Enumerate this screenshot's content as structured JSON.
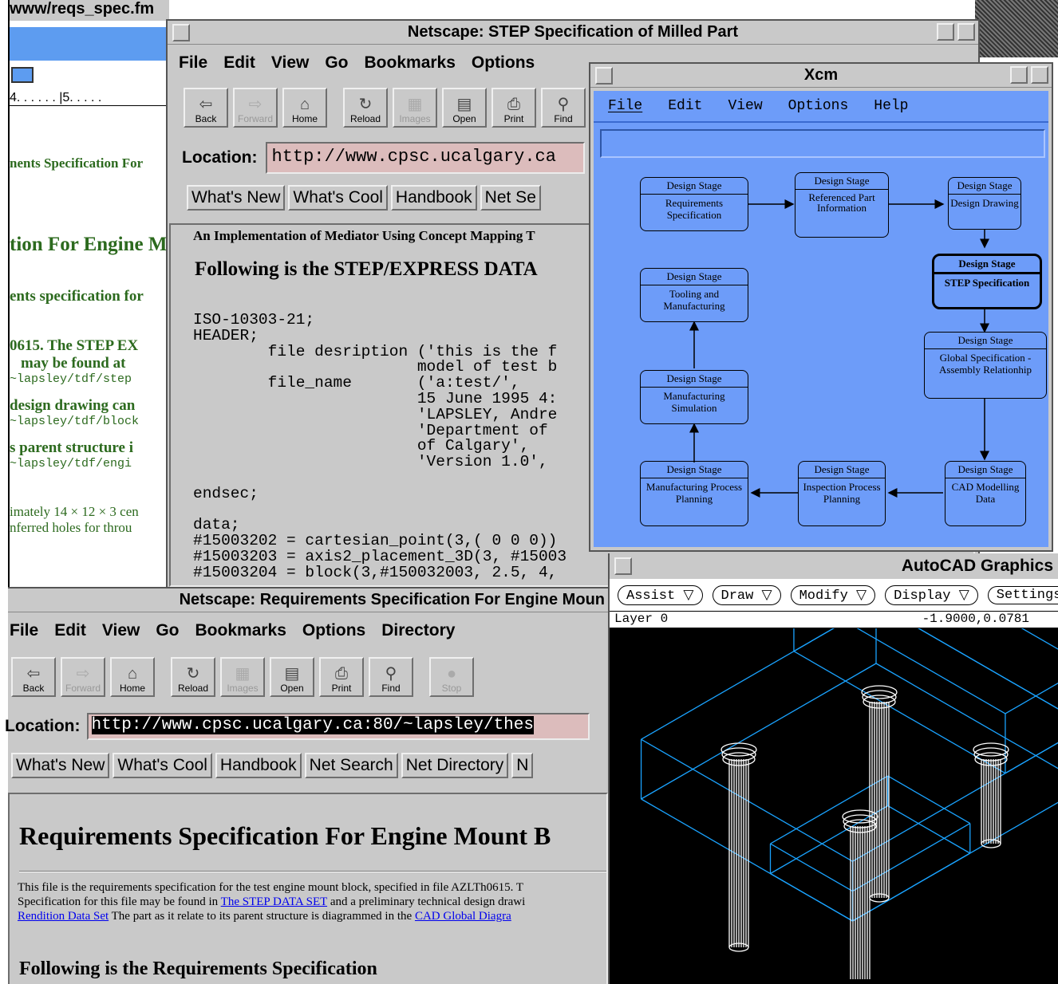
{
  "fm": {
    "title": "www/reqs_spec.fm",
    "ruler": "4. . . . . . |5. . . . .",
    "lines": [
      "nents Specification For",
      "tion For Engine M",
      "ents specification for",
      "0615. The STEP EX",
      "may be found at",
      "~lapsley/tdf/step",
      "design drawing can",
      "~lapsley/tdf/block",
      "s parent structure i",
      "~lapsley/tdf/engi",
      "imately 14 × 12 × 3 cen",
      "nferred holes for throu"
    ]
  },
  "nav1": {
    "title": "Netscape: STEP Specification of Milled Part",
    "menu": [
      "File",
      "Edit",
      "View",
      "Go",
      "Bookmarks",
      "Options"
    ],
    "toolbar": [
      {
        "label": "Back",
        "icon": "back-arrow-icon",
        "glyph": "⇦"
      },
      {
        "label": "Forward",
        "icon": "forward-arrow-icon",
        "glyph": "⇨"
      },
      {
        "label": "Home",
        "icon": "home-icon",
        "glyph": "⌂"
      },
      {
        "label": "Reload",
        "icon": "reload-icon",
        "glyph": "↻"
      },
      {
        "label": "Images",
        "icon": "images-icon",
        "glyph": "▦"
      },
      {
        "label": "Open",
        "icon": "open-icon",
        "glyph": "▤"
      },
      {
        "label": "Print",
        "icon": "print-icon",
        "glyph": "⎙"
      },
      {
        "label": "Find",
        "icon": "find-icon",
        "glyph": "⚲"
      }
    ],
    "location_label": "Location:",
    "location_value": "http://www.cpsc.ucalgary.ca",
    "dirbuttons": [
      "What's New",
      "What's Cool",
      "Handbook",
      "Net Se"
    ],
    "header": "An Implementation of Mediator Using Concept Mapping T",
    "heading": "Following is the STEP/EXPRESS DATA",
    "code": "ISO-10303-21;\nHEADER;\n        file desription ('this is the f\n                        model of test b\n        file_name       ('a:test/',\n                        15 June 1995 4:\n                        'LAPSLEY, Andre\n                        'Department of\n                        of Calgary',\n                        'Version 1.0',\n\nendsec;\n\ndata;\n#15003202 = cartesian_point(3,( 0 0 0))\n#15003203 = axis2_placement_3D(3, #15003\n#15003204 = block(3,#150032003, 2.5, 4,"
  },
  "xcm": {
    "title": "Xcm",
    "menu": [
      "File",
      "Edit",
      "View",
      "Options",
      "Help"
    ],
    "stages": [
      {
        "head": "Design Stage",
        "body": "Requirements Specification"
      },
      {
        "head": "Design Stage",
        "body": "Referenced Part Information"
      },
      {
        "head": "Design Stage",
        "body": "Design Drawing"
      },
      {
        "head": "Design Stage",
        "body": "STEP Specification"
      },
      {
        "head": "Design Stage",
        "body": "Tooling and Manufacturing"
      },
      {
        "head": "Design Stage",
        "body": "Global Specification - Assembly Relationhip"
      },
      {
        "head": "Design Stage",
        "body": "Manufacturing Simulation"
      },
      {
        "head": "Design Stage",
        "body": "Manufacturing Process Planning"
      },
      {
        "head": "Design Stage",
        "body": "Inspection Process Planning"
      },
      {
        "head": "Design Stage",
        "body": "CAD Modelling Data"
      }
    ]
  },
  "nav2": {
    "title": "Netscape: Requirements Specification For Engine Moun",
    "menu": [
      "File",
      "Edit",
      "View",
      "Go",
      "Bookmarks",
      "Options",
      "Directory"
    ],
    "toolbar": [
      {
        "label": "Back",
        "icon": "back-arrow-icon",
        "glyph": "⇦"
      },
      {
        "label": "Forward",
        "icon": "forward-arrow-icon",
        "glyph": "⇨"
      },
      {
        "label": "Home",
        "icon": "home-icon",
        "glyph": "⌂"
      },
      {
        "label": "Reload",
        "icon": "reload-icon",
        "glyph": "↻"
      },
      {
        "label": "Images",
        "icon": "images-icon",
        "glyph": "▦"
      },
      {
        "label": "Open",
        "icon": "open-icon",
        "glyph": "▤"
      },
      {
        "label": "Print",
        "icon": "print-icon",
        "glyph": "⎙"
      },
      {
        "label": "Find",
        "icon": "find-icon",
        "glyph": "⚲"
      },
      {
        "label": "Stop",
        "icon": "stop-icon",
        "glyph": "●"
      }
    ],
    "location_label": "Location:",
    "location_value": "http://www.cpsc.ucalgary.ca:80/~lapsley/thes",
    "dirbuttons": [
      "What's New",
      "What's Cool",
      "Handbook",
      "Net Search",
      "Net Directory",
      "N"
    ],
    "heading": "Requirements Specification For Engine Mount B",
    "para1": "This file is the requirements specification for the test engine mount block, specified in file AZLTh0615. T",
    "para2_pre": "Specification for this file may be found in ",
    "para2_link": "The STEP DATA SET",
    "para2_post": " and a preliminary technical design drawi",
    "para3_link1": "Rendition Data Set",
    "para3_mid": " The part as it relate to its parent structure is diagrammed in the ",
    "para3_link2": "CAD Global Diagra",
    "heading2": "Following is the Requirements Specification"
  },
  "acad": {
    "title": "AutoCAD Graphics",
    "menus": [
      "Assist ▽",
      "Draw ▽",
      "Modify ▽",
      "Display ▽",
      "Settings"
    ],
    "layer": "Layer 0",
    "coords": "-1.9000,0.0781",
    "wire_color": "#1aa3ff"
  }
}
